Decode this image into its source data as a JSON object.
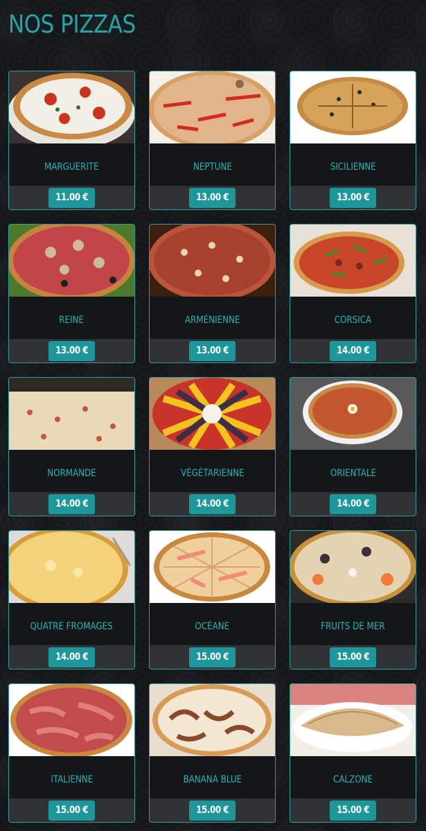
{
  "page": {
    "title": "NOS PIZZAS"
  },
  "pizzas": [
    {
      "name": "MARGUERITE",
      "price": "11.00 €",
      "image": "pizza-photo"
    },
    {
      "name": "NEPTUNE",
      "price": "13.00 €",
      "image": "pizza-photo"
    },
    {
      "name": "SICILIENNE",
      "price": "13.00 €",
      "image": "pizza-photo"
    },
    {
      "name": "REINE",
      "price": "13.00 €",
      "image": "pizza-photo"
    },
    {
      "name": "ARMÉNIENNE",
      "price": "13.00 €",
      "image": "pizza-photo"
    },
    {
      "name": "CORSICA",
      "price": "14.00 €",
      "image": "pizza-photo"
    },
    {
      "name": "NORMANDE",
      "price": "14.00 €",
      "image": "pizza-photo"
    },
    {
      "name": "VÉGÉTARIENNE",
      "price": "14.00 €",
      "image": "pizza-photo"
    },
    {
      "name": "ORIENTALE",
      "price": "14.00 €",
      "image": "pizza-photo"
    },
    {
      "name": "QUATRE FROMAGES",
      "price": "14.00 €",
      "image": "pizza-photo"
    },
    {
      "name": "OCÉANE",
      "price": "15.00 €",
      "image": "pizza-photo"
    },
    {
      "name": "FRUITS DE MER",
      "price": "15.00 €",
      "image": "pizza-photo"
    },
    {
      "name": "ITALIENNE",
      "price": "15.00 €",
      "image": "pizza-photo"
    },
    {
      "name": "BANANA BLUE",
      "price": "15.00 €",
      "image": "pizza-photo"
    },
    {
      "name": "CALZONE",
      "price": "15.00 €",
      "image": "pizza-photo"
    }
  ],
  "colors": {
    "accent": "#22a6aa",
    "price_badge": "#1e979b",
    "price_band": "#303236",
    "background": "#16171a"
  }
}
